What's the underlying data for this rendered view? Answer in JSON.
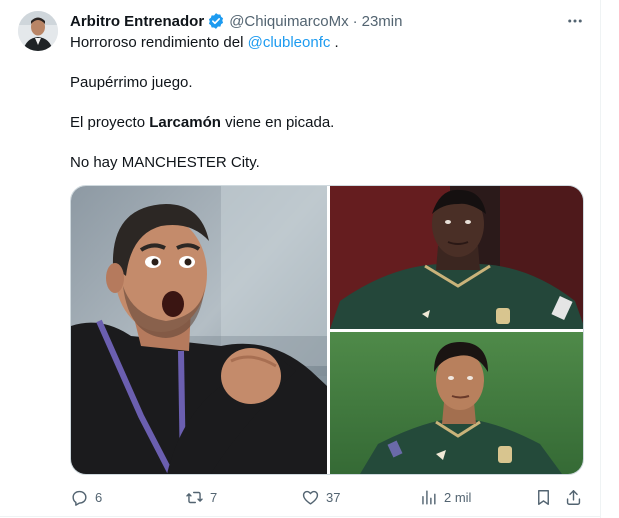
{
  "tweet": {
    "display_name": "Arbitro Entrenador",
    "handle": "@ChiquimarcoMx",
    "separator": "·",
    "time": "23min",
    "line1_prefix": "Horroroso rendimiento del ",
    "line1_mention": "@clubleonfc",
    "line1_suffix": " .",
    "line2": "Paupérrimo juego.",
    "line3_prefix": "El proyecto ",
    "line3_bold": "Larcamón",
    "line3_suffix": " viene en picada.",
    "line4": "No hay MANCHESTER City."
  },
  "actions": {
    "replies": "6",
    "reposts": "7",
    "likes": "37",
    "views": "2 mil"
  },
  "colors": {
    "accent": "#1d9bf0",
    "secondary_text": "#536471",
    "jersey_green": "#1f4a34",
    "pitch_green": "#3f7a3c"
  },
  "icons": [
    "verified-badge-icon",
    "more-icon",
    "reply-icon",
    "repost-icon",
    "like-icon",
    "views-icon",
    "bookmark-icon",
    "share-icon"
  ]
}
